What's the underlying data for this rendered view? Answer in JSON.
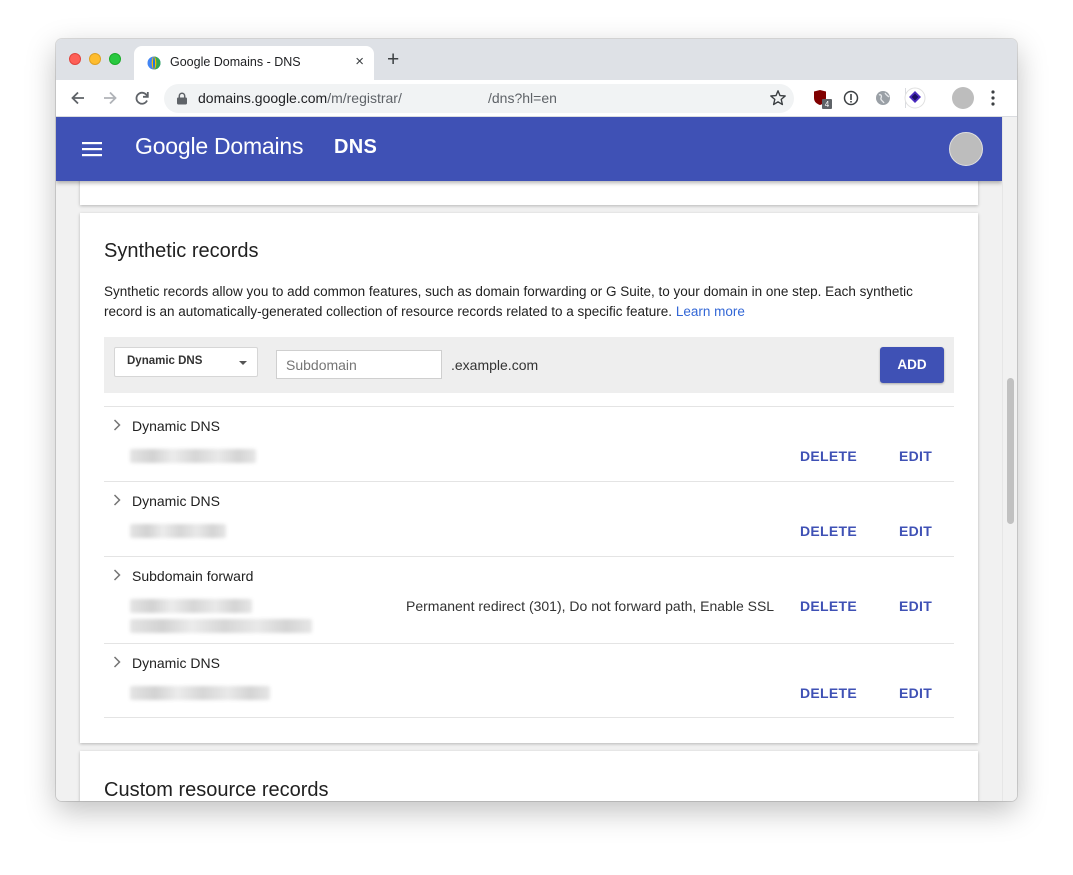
{
  "browser": {
    "tab": {
      "title": "Google Domains - DNS",
      "close": "×"
    },
    "new_tab": "+",
    "url": {
      "host": "domains.google.com",
      "path": "/m/registrar/",
      "rest": "/dns?hl=en"
    },
    "extension_badge": "4"
  },
  "appbar": {
    "brand_google": "Google",
    "brand_domains": "Domains",
    "section": "DNS",
    "color": "#3f51b5"
  },
  "synthetic": {
    "title": "Synthetic records",
    "description": "Synthetic records allow you to add common features, such as domain forwarding or G Suite, to your domain in one step. Each synthetic record is an automatically-generated collection of resource records related to a specific feature.",
    "learn_more": "Learn more",
    "add_bar": {
      "type_selected": "Dynamic DNS",
      "subdomain_placeholder": "Subdomain",
      "suffix": ".example.com",
      "add_label": "ADD"
    },
    "records": [
      {
        "type": "Dynamic DNS",
        "detail": "",
        "delete": "DELETE",
        "edit": "EDIT"
      },
      {
        "type": "Dynamic DNS",
        "detail": "",
        "delete": "DELETE",
        "edit": "EDIT"
      },
      {
        "type": "Subdomain forward",
        "detail": "Permanent redirect (301), Do not forward path, Enable SSL",
        "delete": "DELETE",
        "edit": "EDIT"
      },
      {
        "type": "Dynamic DNS",
        "detail": "",
        "delete": "DELETE",
        "edit": "EDIT"
      }
    ]
  },
  "custom": {
    "title": "Custom resource records"
  }
}
